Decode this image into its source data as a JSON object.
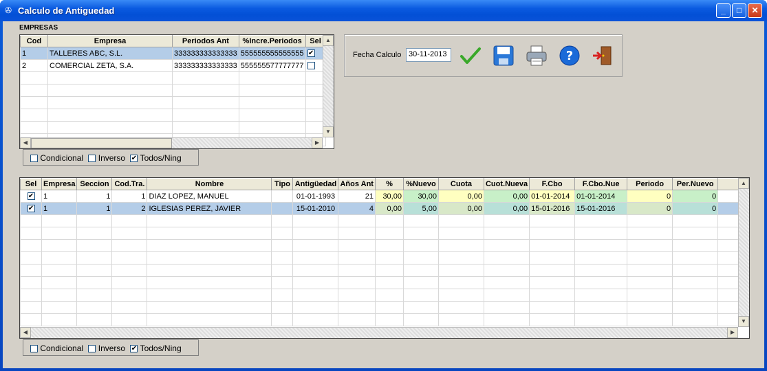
{
  "window": {
    "title": "Calculo de Antiguedad"
  },
  "empresas": {
    "label": "EMPRESAS",
    "columns": [
      "Cod",
      "Empresa",
      "Periodos Ant",
      "%Incre.Periodos",
      "Sel"
    ],
    "rows": [
      {
        "cod": "1",
        "empresa": "TALLERES ABC, S.L.",
        "periodos": "333333333333333",
        "incre": "555555555555555",
        "sel": "✔"
      },
      {
        "cod": "2",
        "empresa": "COMERCIAL ZETA, S.A.",
        "periodos": "333333333333333",
        "incre": "555555577777777",
        "sel": ""
      }
    ]
  },
  "filter_top": {
    "condicional": "Condicional",
    "inverso": "Inverso",
    "todos": "Todos/Ning",
    "todos_checked": "✔"
  },
  "fecha": {
    "label": "Fecha Calculo",
    "value": "30-11-2013"
  },
  "toolbar_icons": [
    "check-icon",
    "save-icon",
    "print-icon",
    "help-icon",
    "exit-icon"
  ],
  "empleados": {
    "columns": [
      "Sel",
      "Empresa",
      "Seccion",
      "Cod.Tra.",
      "Nombre",
      "Tipo",
      "Antigüedad",
      "Años Ant",
      "%",
      "%Nuevo",
      "Cuota",
      "Cuot.Nueva",
      "F.Cbo",
      "F.Cbo.Nue",
      "Periodo",
      "Per.Nuevo"
    ],
    "rows": [
      {
        "sel": "✔",
        "empresa": "1",
        "seccion": "1",
        "codtra": "1",
        "nombre": "DIAZ  LOPEZ, MANUEL",
        "tipo": "",
        "antig": "01-01-1993",
        "anos": "21",
        "pct": "30,00",
        "pctnuevo": "30,00",
        "cuota": "0,00",
        "cuotnueva": "0,00",
        "fcbo": "01-01-2014",
        "fcbonue": "01-01-2014",
        "periodo": "0",
        "pernuevo": "0"
      },
      {
        "sel": "✔",
        "empresa": "1",
        "seccion": "1",
        "codtra": "2",
        "nombre": "IGLESIAS PEREZ, JAVIER",
        "tipo": "",
        "antig": "15-01-2010",
        "anos": "4",
        "pct": "0,00",
        "pctnuevo": "5,00",
        "cuota": "0,00",
        "cuotnueva": "0,00",
        "fcbo": "15-01-2016",
        "fcbonue": "15-01-2016",
        "periodo": "0",
        "pernuevo": "0"
      }
    ]
  },
  "filter_bottom": {
    "condicional": "Condicional",
    "inverso": "Inverso",
    "todos": "Todos/Ning",
    "todos_checked": "✔"
  }
}
